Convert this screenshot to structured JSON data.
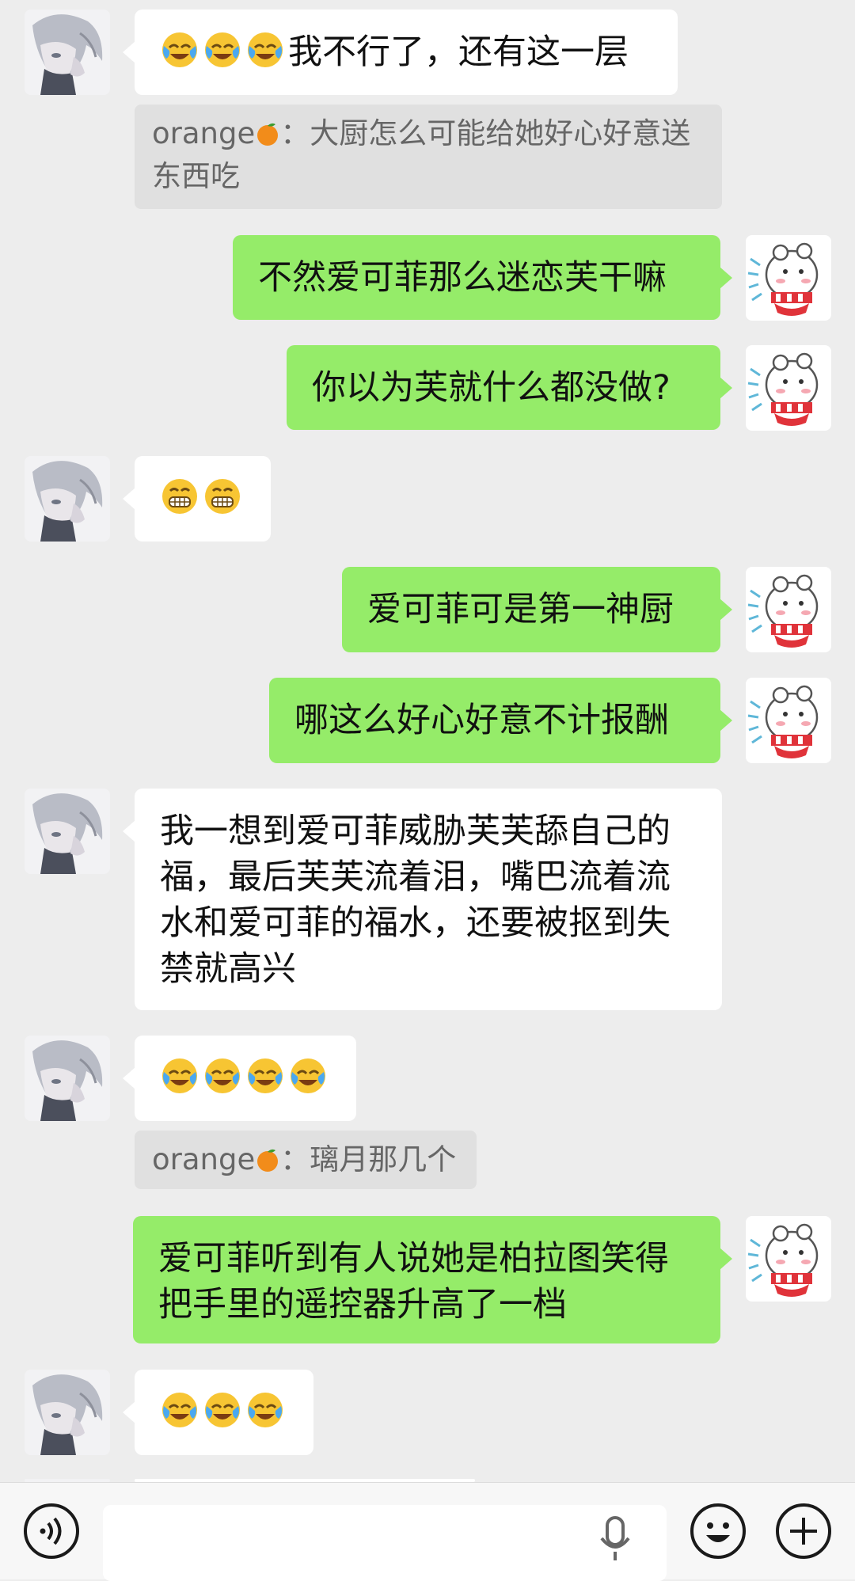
{
  "messages": [
    {
      "side": "in",
      "text": "我不行了，还有这一层",
      "emojis": 3,
      "quote": {
        "author": "orange",
        "text": "大厨怎么可能给她好心好意送东西吃",
        "line1": "大厨怎么可能给她好心好意送",
        "line2": "东西吃"
      }
    },
    {
      "side": "out",
      "text": "不然爱可菲那么迷恋芙干嘛"
    },
    {
      "side": "out",
      "text": "你以为芙就什么都没做?"
    },
    {
      "side": "in",
      "emoji_grin": 2
    },
    {
      "side": "out",
      "text": "爱可菲可是第一神厨"
    },
    {
      "side": "out",
      "text": "哪这么好心好意不计报酬"
    },
    {
      "side": "in",
      "text": "我一想到爱可菲威胁芙芙舔自己的福，最后芙芙流着泪，嘴巴流着流水和爱可菲的福水，还要被抠到失禁就高兴",
      "lines": [
        "我一想到爱可菲威胁芙芙舔自己的",
        "福，最后芙芙流着泪，嘴巴流着流",
        "水和爱可菲的福水，还要被抠到失",
        "禁就高兴"
      ]
    },
    {
      "side": "in",
      "emojis": 4,
      "quote": {
        "author": "orange",
        "text": "璃月那几个"
      }
    },
    {
      "side": "out",
      "text": "爱可菲听到有人说她是柏拉图笑得把手里的遥控器升高了一档",
      "lines": [
        "爱可菲听到有人说她是柏拉图笑得",
        "把手里的遥控器升高了一档"
      ]
    },
    {
      "side": "in",
      "emojis": 3
    }
  ],
  "quote_separator": "：",
  "input": {
    "placeholder": ""
  },
  "colors": {
    "background": "#ededed",
    "incoming": "#ffffff",
    "outgoing": "#95ec69",
    "quote": "#e0e0e0"
  },
  "icons": [
    "voice-toggle-icon",
    "microphone-icon",
    "emoji-icon",
    "plus-icon"
  ]
}
